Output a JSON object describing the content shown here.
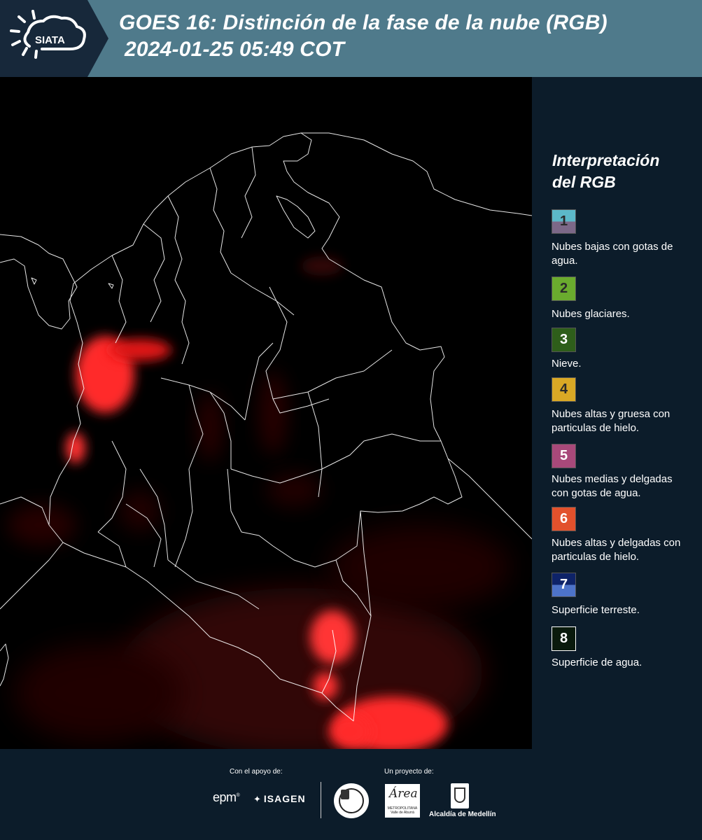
{
  "header": {
    "logo_text": "SIATA",
    "title_line1": "GOES 16: Distinción de la fase de la nube (RGB)",
    "title_line2": "2024-01-25 05:49 COT",
    "background_color": "#4f7a8b"
  },
  "legend": {
    "title_line1": "Interpretación",
    "title_line2": "del RGB",
    "items": [
      {
        "number": "1",
        "label": "Nubes bajas con gotas de agua.",
        "colors": [
          "#5cb8c8",
          "#7c6888"
        ]
      },
      {
        "number": "2",
        "label": "Nubes glaciares.",
        "colors": [
          "#6aab2e"
        ]
      },
      {
        "number": "3",
        "label": "Nieve.",
        "colors": [
          "#2e5e1a"
        ]
      },
      {
        "number": "4",
        "label": "Nubes altas y gruesa con particulas de hielo.",
        "colors": [
          "#d9a825"
        ]
      },
      {
        "number": "5",
        "label": "Nubes medias y delgadas con gotas de agua.",
        "colors": [
          "#a8497a"
        ]
      },
      {
        "number": "6",
        "label": "Nubes altas y delgadas con particulas de hielo.",
        "colors": [
          "#e2512c"
        ]
      },
      {
        "number": "7",
        "label": "Superficie terreste.",
        "colors": [
          "#0e2368",
          "#4d73c9"
        ]
      },
      {
        "number": "8",
        "label": "Superficie de agua.",
        "colors": [
          "#0a1a0c"
        ]
      }
    ]
  },
  "footer": {
    "support_caption": "Con el apoyo de:",
    "project_caption": "Un proyecto de:",
    "sponsor1": "epm",
    "sponsor2": "ISAGEN",
    "area_logo_script": "Área",
    "area_logo_text": "METROPOLITANA Valle de Aburrá",
    "alcaldia": "Alcaldía de Medellín"
  },
  "colors": {
    "page_background": "#0c1c2a",
    "map_background": "#000000",
    "cloud_signal": "#ff2020",
    "borders": "#ffffff"
  }
}
